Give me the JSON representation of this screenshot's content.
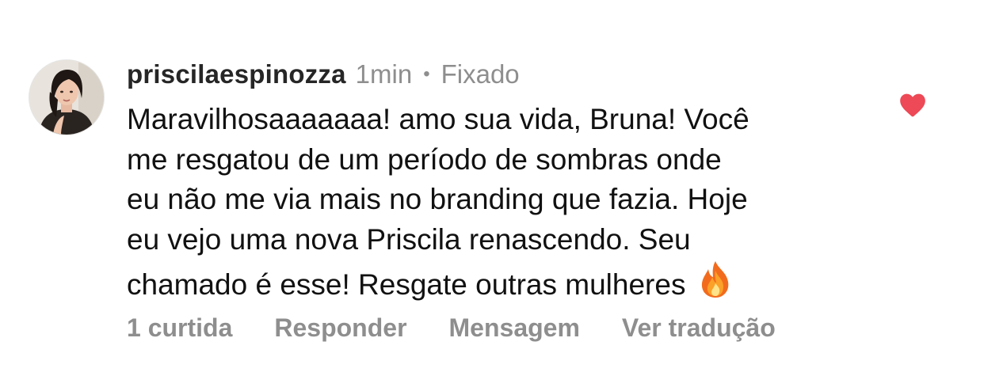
{
  "comment": {
    "username": "priscilaespinozza",
    "time": "1min",
    "separator": "•",
    "pinned_label": "Fixado",
    "text": "Maravilhosaaaaaaa! amo sua vida, Bruna! Você\nme resgatou de um período de sombras onde\neu não me via mais no branding que fazia. Hoje\neu vejo uma nova Priscila renascendo. Seu\nchamado é esse! Resgate outras mulheres",
    "trailing_emoji": "fire-emoji",
    "liked": true,
    "like_icon": "heart-icon",
    "like_color": "#ed4956"
  },
  "actions": {
    "likes": "1 curtida",
    "reply": "Responder",
    "message": "Mensagem",
    "translate": "Ver tradução"
  },
  "colors": {
    "text": "#111111",
    "username": "#262626",
    "secondary": "#8e8e8e",
    "heart": "#ed4956"
  }
}
